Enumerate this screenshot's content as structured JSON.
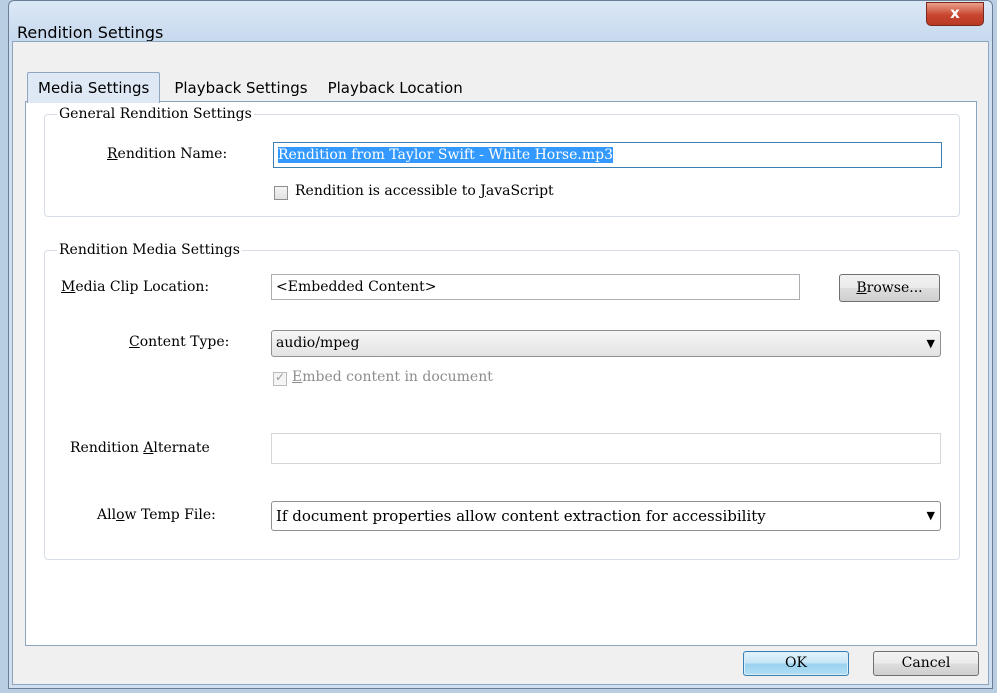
{
  "window": {
    "title": "Rendition Settings",
    "close_label": "x"
  },
  "tabs": [
    {
      "label": "Media Settings"
    },
    {
      "label": "Playback Settings"
    },
    {
      "label": "Playback Location"
    }
  ],
  "general": {
    "legend": "General Rendition Settings",
    "name_label_pre": "",
    "name_label_key": "R",
    "name_label_post": "endition Name:",
    "name_value": "Rendition from Taylor Swift - White Horse.mp3",
    "js_checkbox_pre": "Rendition is accessible to ",
    "js_checkbox_key": "J",
    "js_checkbox_post": "avaScript",
    "js_checked": false
  },
  "media": {
    "legend": "Rendition Media Settings",
    "clip_label_key": "M",
    "clip_label_post": "edia Clip Location:",
    "clip_value": "<Embedded Content>",
    "browse_key": "B",
    "browse_post": "rowse...",
    "content_type_key": "C",
    "content_type_post": "ontent Type:",
    "content_type_value": "audio/mpeg",
    "embed_key": "E",
    "embed_post": "mbed content in document",
    "embed_checked": true,
    "alternate_pre": "Rendition ",
    "alternate_key": "A",
    "alternate_post": "lternate",
    "alternate_value": "",
    "temp_pre": "All",
    "temp_key": "o",
    "temp_post": "w Temp File:",
    "temp_value": "If document properties allow content extraction for accessibility"
  },
  "footer": {
    "ok_label": "OK",
    "cancel_label": "Cancel"
  },
  "colors": {
    "selection": "#3399ff",
    "default_button": "#98d1ef",
    "close_button": "#c8452f"
  }
}
